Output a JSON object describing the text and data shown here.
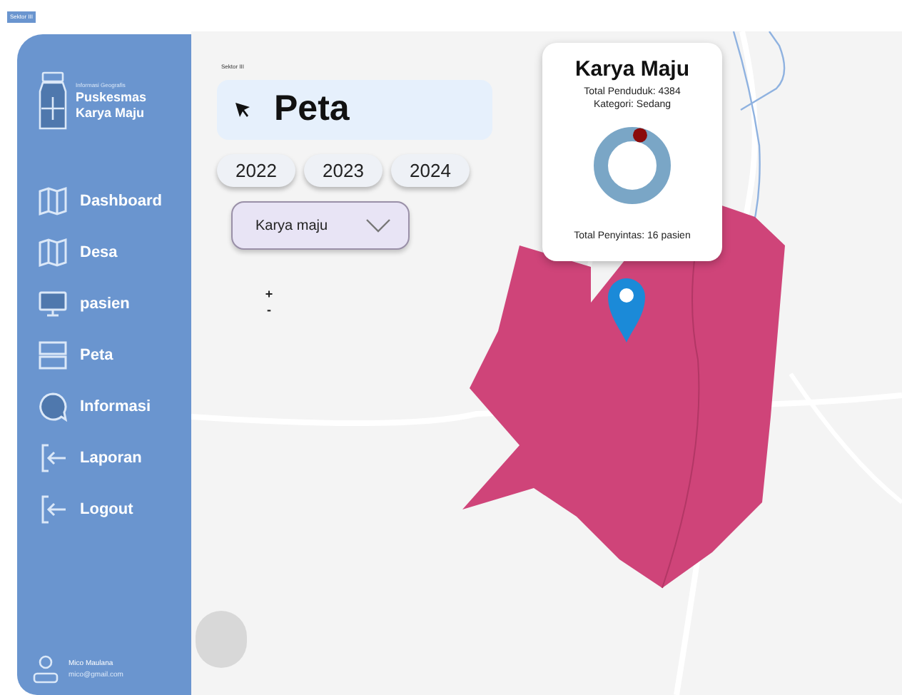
{
  "top_badge": "Sektor III",
  "sidebar": {
    "subtitle": "Informasi Geografis",
    "title_lines": [
      "Puskesmas",
      "Karya Maju"
    ],
    "items": [
      {
        "label": "Dashboard",
        "kind": "map",
        "selected": false
      },
      {
        "label": "Desa",
        "kind": "map",
        "selected": false
      },
      {
        "label": "pasien",
        "kind": "monitor",
        "selected": false
      },
      {
        "label": "Peta",
        "kind": "layers",
        "selected": false
      },
      {
        "label": "Informasi",
        "kind": "chat",
        "selected": false
      },
      {
        "label": "Laporan",
        "kind": "exit",
        "selected": false
      },
      {
        "label": "Logout",
        "kind": "exit",
        "selected": false
      }
    ],
    "user": {
      "name": "Mico Maulana",
      "email": "mico@gmail.com"
    }
  },
  "header": {
    "section_label": "Sektor III",
    "title": "Peta"
  },
  "years": [
    {
      "label": "2022",
      "selected": false
    },
    {
      "label": "2023",
      "selected": false
    },
    {
      "label": "2024",
      "selected": false
    }
  ],
  "village_select": {
    "value": "Karya maju"
  },
  "zoom_controls": [
    "+",
    "-"
  ],
  "info_card": {
    "title": "Karya Maju",
    "population": "Total Penduduk: 4384",
    "category": "Kategori: Sedang",
    "survivors": "Total Penyintas: 16 pasien"
  }
}
